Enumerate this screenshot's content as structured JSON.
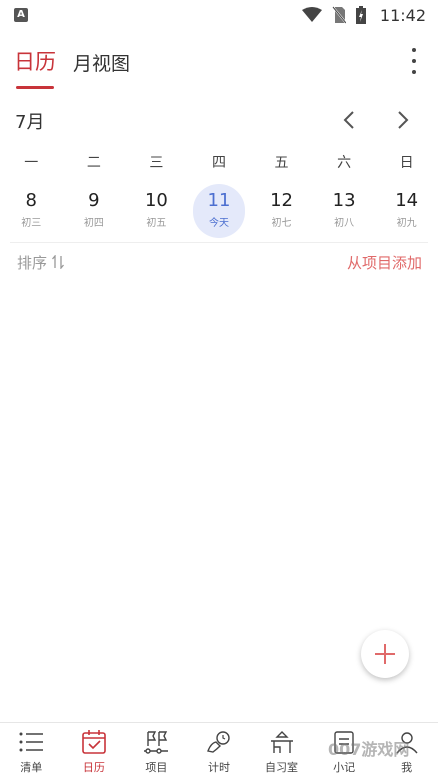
{
  "status_bar": {
    "time": "11:42",
    "icons": [
      "app-notification-icon",
      "wifi-icon",
      "no-sim-icon",
      "battery-icon"
    ]
  },
  "top_tabs": {
    "calendar": "日历",
    "month_view": "月视图",
    "active": "calendar"
  },
  "month_header": {
    "label": "7月"
  },
  "weekdays": [
    "一",
    "二",
    "三",
    "四",
    "五",
    "六",
    "日"
  ],
  "days": [
    {
      "num": "8",
      "lunar": "初三"
    },
    {
      "num": "9",
      "lunar": "初四"
    },
    {
      "num": "10",
      "lunar": "初五"
    },
    {
      "num": "11",
      "lunar": "今天",
      "today": true
    },
    {
      "num": "12",
      "lunar": "初七"
    },
    {
      "num": "13",
      "lunar": "初八"
    },
    {
      "num": "14",
      "lunar": "初九"
    }
  ],
  "list_toolbar": {
    "sort_label": "排序",
    "add_from_project": "从项目添加"
  },
  "bottom_nav": [
    {
      "label": "清单",
      "icon": "list-icon"
    },
    {
      "label": "日历",
      "icon": "calendar-icon",
      "active": true
    },
    {
      "label": "项目",
      "icon": "project-flags-icon"
    },
    {
      "label": "计时",
      "icon": "timer-hand-icon"
    },
    {
      "label": "自习室",
      "icon": "study-room-icon"
    },
    {
      "label": "小记",
      "icon": "notes-icon"
    },
    {
      "label": "我",
      "icon": "profile-icon"
    }
  ],
  "watermark": "007游戏网",
  "colors": {
    "accent": "#c8343a",
    "today_bg": "#e4e9fa",
    "today_text": "#4c6fd0",
    "add_link": "#e06a6a"
  }
}
